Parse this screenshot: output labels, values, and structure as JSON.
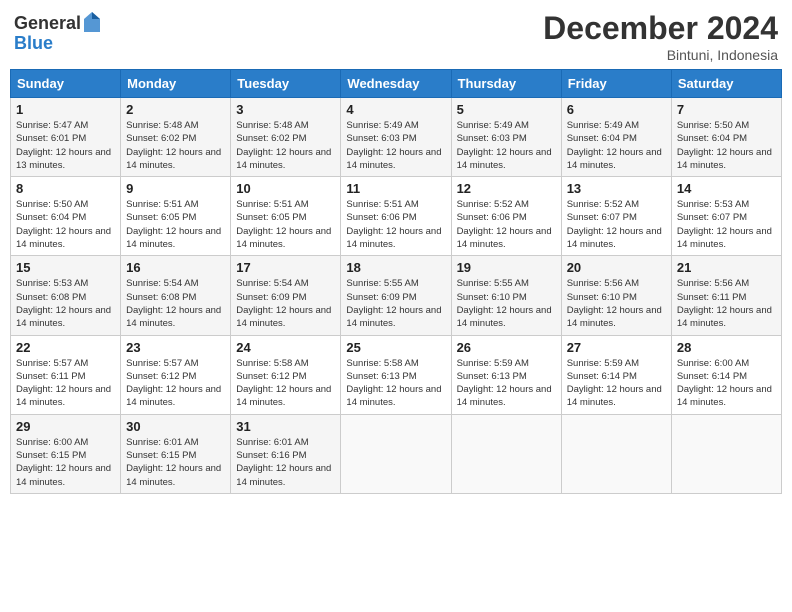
{
  "header": {
    "logo_general": "General",
    "logo_blue": "Blue",
    "month_title": "December 2024",
    "subtitle": "Bintuni, Indonesia"
  },
  "days_of_week": [
    "Sunday",
    "Monday",
    "Tuesday",
    "Wednesday",
    "Thursday",
    "Friday",
    "Saturday"
  ],
  "weeks": [
    [
      {
        "day": "1",
        "sunrise": "5:47 AM",
        "sunset": "6:01 PM",
        "daylight": "12 hours and 13 minutes."
      },
      {
        "day": "2",
        "sunrise": "5:48 AM",
        "sunset": "6:02 PM",
        "daylight": "12 hours and 14 minutes."
      },
      {
        "day": "3",
        "sunrise": "5:48 AM",
        "sunset": "6:02 PM",
        "daylight": "12 hours and 14 minutes."
      },
      {
        "day": "4",
        "sunrise": "5:49 AM",
        "sunset": "6:03 PM",
        "daylight": "12 hours and 14 minutes."
      },
      {
        "day": "5",
        "sunrise": "5:49 AM",
        "sunset": "6:03 PM",
        "daylight": "12 hours and 14 minutes."
      },
      {
        "day": "6",
        "sunrise": "5:49 AM",
        "sunset": "6:04 PM",
        "daylight": "12 hours and 14 minutes."
      },
      {
        "day": "7",
        "sunrise": "5:50 AM",
        "sunset": "6:04 PM",
        "daylight": "12 hours and 14 minutes."
      }
    ],
    [
      {
        "day": "8",
        "sunrise": "5:50 AM",
        "sunset": "6:04 PM",
        "daylight": "12 hours and 14 minutes."
      },
      {
        "day": "9",
        "sunrise": "5:51 AM",
        "sunset": "6:05 PM",
        "daylight": "12 hours and 14 minutes."
      },
      {
        "day": "10",
        "sunrise": "5:51 AM",
        "sunset": "6:05 PM",
        "daylight": "12 hours and 14 minutes."
      },
      {
        "day": "11",
        "sunrise": "5:51 AM",
        "sunset": "6:06 PM",
        "daylight": "12 hours and 14 minutes."
      },
      {
        "day": "12",
        "sunrise": "5:52 AM",
        "sunset": "6:06 PM",
        "daylight": "12 hours and 14 minutes."
      },
      {
        "day": "13",
        "sunrise": "5:52 AM",
        "sunset": "6:07 PM",
        "daylight": "12 hours and 14 minutes."
      },
      {
        "day": "14",
        "sunrise": "5:53 AM",
        "sunset": "6:07 PM",
        "daylight": "12 hours and 14 minutes."
      }
    ],
    [
      {
        "day": "15",
        "sunrise": "5:53 AM",
        "sunset": "6:08 PM",
        "daylight": "12 hours and 14 minutes."
      },
      {
        "day": "16",
        "sunrise": "5:54 AM",
        "sunset": "6:08 PM",
        "daylight": "12 hours and 14 minutes."
      },
      {
        "day": "17",
        "sunrise": "5:54 AM",
        "sunset": "6:09 PM",
        "daylight": "12 hours and 14 minutes."
      },
      {
        "day": "18",
        "sunrise": "5:55 AM",
        "sunset": "6:09 PM",
        "daylight": "12 hours and 14 minutes."
      },
      {
        "day": "19",
        "sunrise": "5:55 AM",
        "sunset": "6:10 PM",
        "daylight": "12 hours and 14 minutes."
      },
      {
        "day": "20",
        "sunrise": "5:56 AM",
        "sunset": "6:10 PM",
        "daylight": "12 hours and 14 minutes."
      },
      {
        "day": "21",
        "sunrise": "5:56 AM",
        "sunset": "6:11 PM",
        "daylight": "12 hours and 14 minutes."
      }
    ],
    [
      {
        "day": "22",
        "sunrise": "5:57 AM",
        "sunset": "6:11 PM",
        "daylight": "12 hours and 14 minutes."
      },
      {
        "day": "23",
        "sunrise": "5:57 AM",
        "sunset": "6:12 PM",
        "daylight": "12 hours and 14 minutes."
      },
      {
        "day": "24",
        "sunrise": "5:58 AM",
        "sunset": "6:12 PM",
        "daylight": "12 hours and 14 minutes."
      },
      {
        "day": "25",
        "sunrise": "5:58 AM",
        "sunset": "6:13 PM",
        "daylight": "12 hours and 14 minutes."
      },
      {
        "day": "26",
        "sunrise": "5:59 AM",
        "sunset": "6:13 PM",
        "daylight": "12 hours and 14 minutes."
      },
      {
        "day": "27",
        "sunrise": "5:59 AM",
        "sunset": "6:14 PM",
        "daylight": "12 hours and 14 minutes."
      },
      {
        "day": "28",
        "sunrise": "6:00 AM",
        "sunset": "6:14 PM",
        "daylight": "12 hours and 14 minutes."
      }
    ],
    [
      {
        "day": "29",
        "sunrise": "6:00 AM",
        "sunset": "6:15 PM",
        "daylight": "12 hours and 14 minutes."
      },
      {
        "day": "30",
        "sunrise": "6:01 AM",
        "sunset": "6:15 PM",
        "daylight": "12 hours and 14 minutes."
      },
      {
        "day": "31",
        "sunrise": "6:01 AM",
        "sunset": "6:16 PM",
        "daylight": "12 hours and 14 minutes."
      },
      null,
      null,
      null,
      null
    ]
  ],
  "labels": {
    "sunrise": "Sunrise:",
    "sunset": "Sunset:",
    "daylight": "Daylight:"
  }
}
